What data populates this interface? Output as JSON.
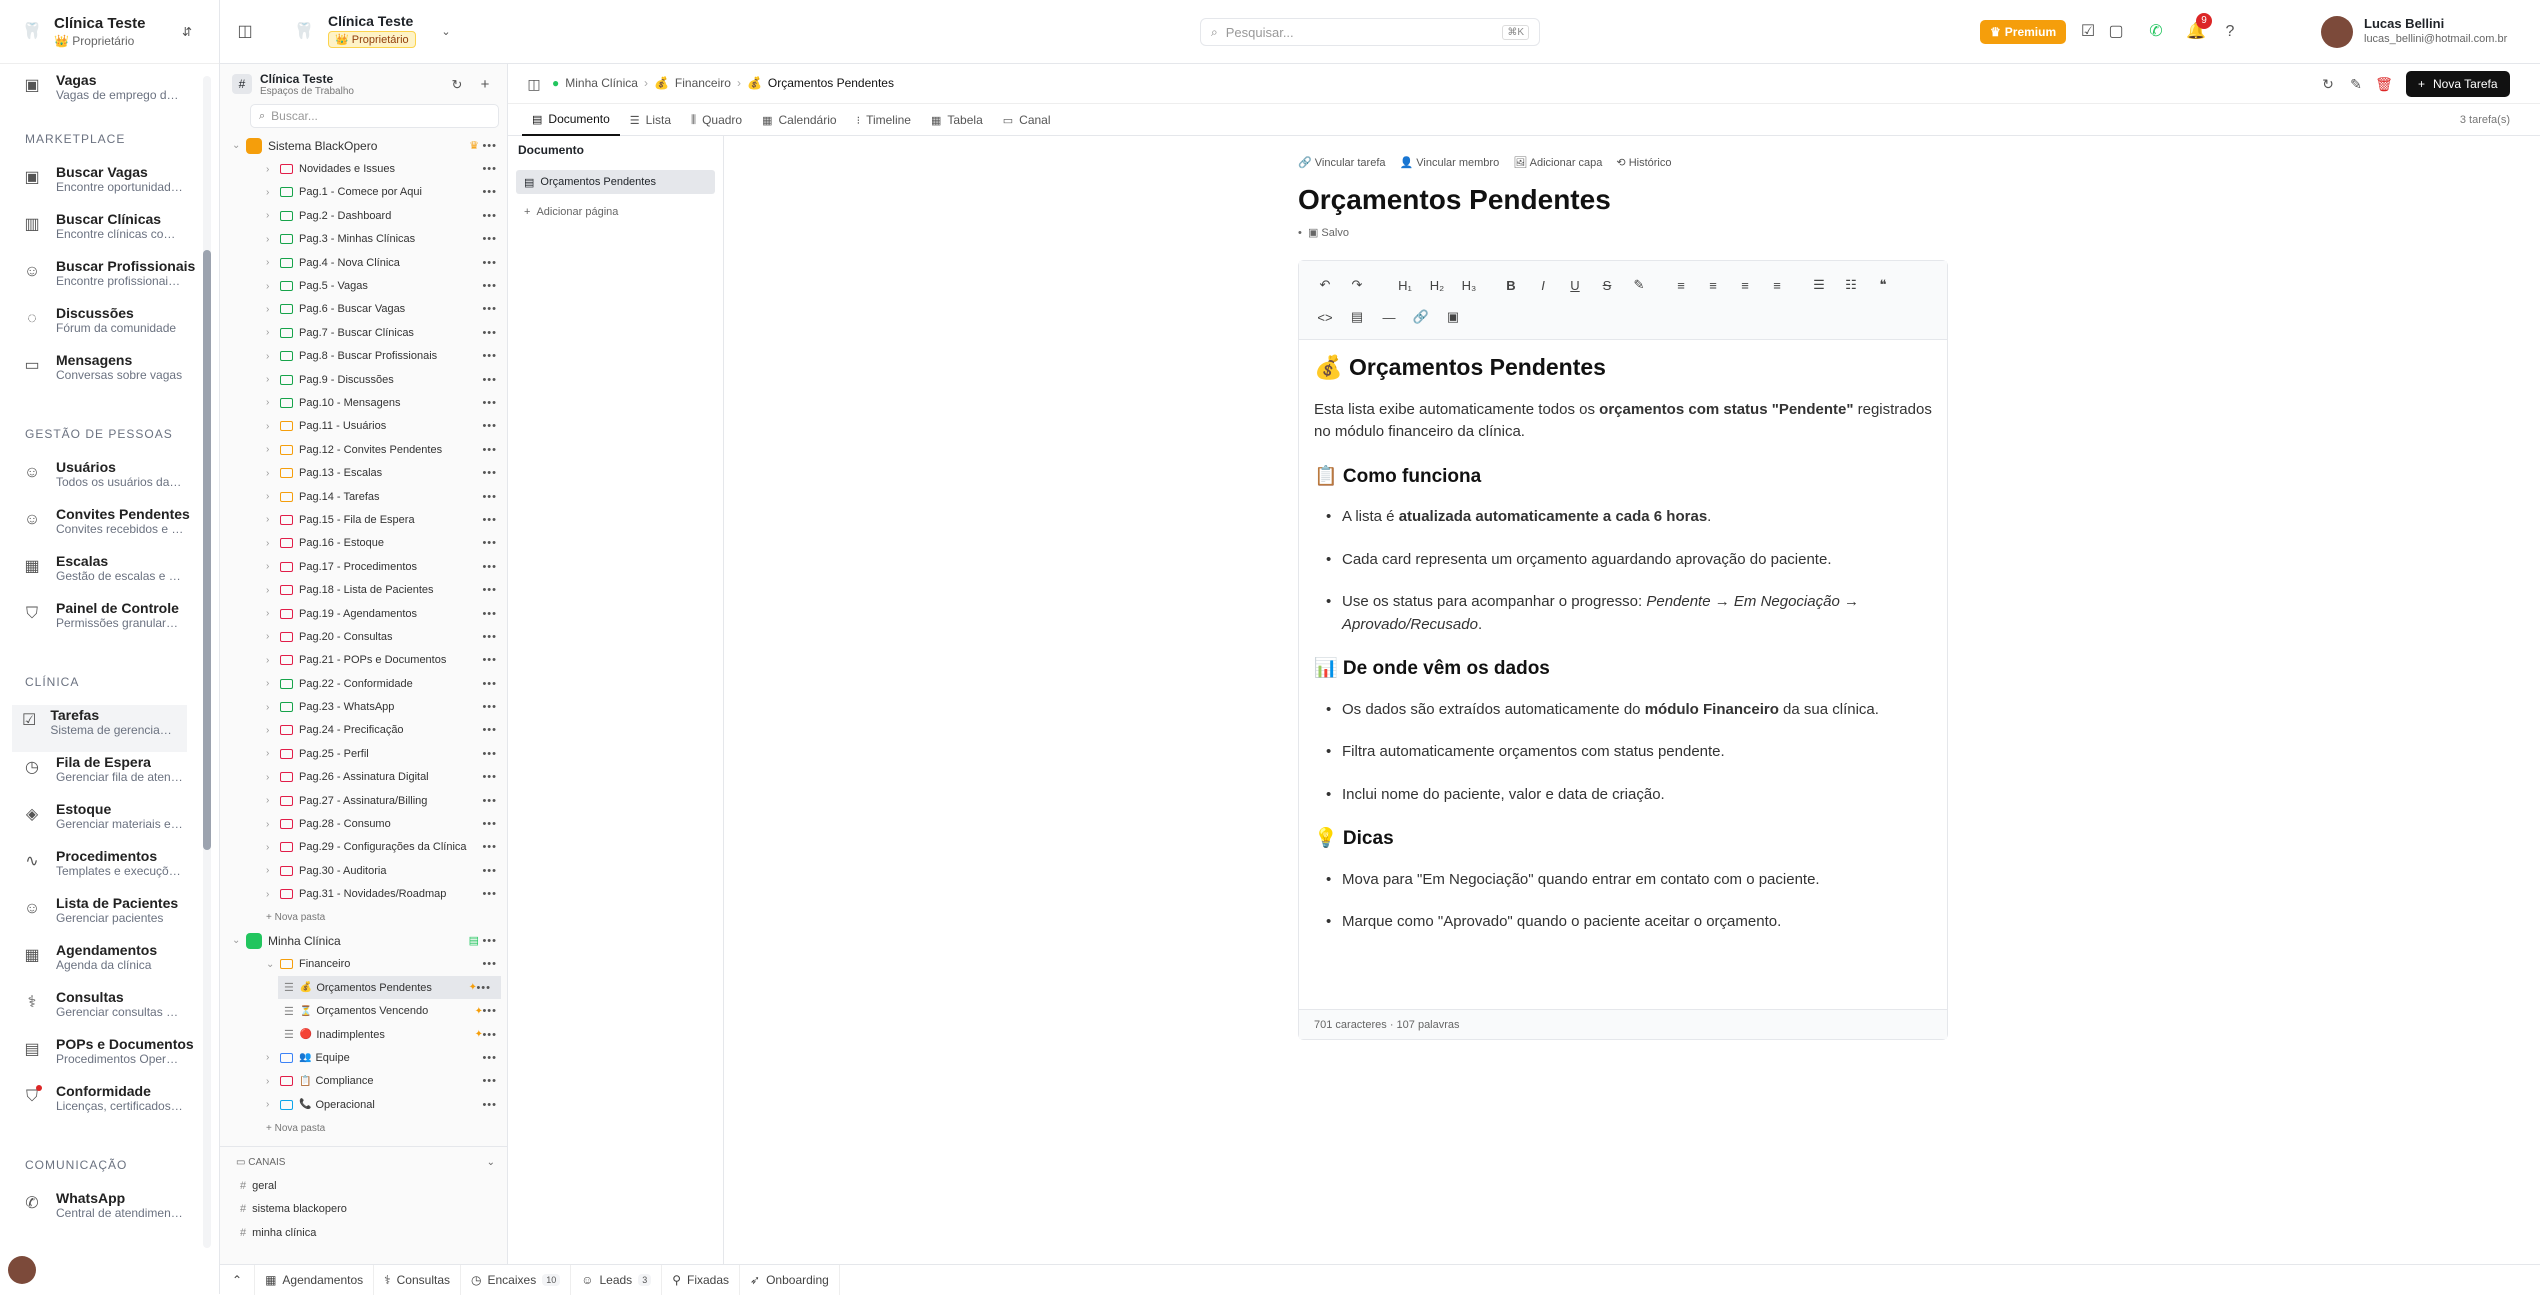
{
  "app": {
    "clinic_name": "Clínica Teste",
    "role": "Proprietário"
  },
  "header": {
    "clinic_name": "Clínica Teste",
    "role": "Proprietário",
    "search_placeholder": "Pesquisar...",
    "search_shortcut": "⌘K",
    "premium_label": "Premium",
    "notif_count": "9",
    "user_name": "Lucas Bellini",
    "user_email": "lucas_bellini@hotmail.com.br"
  },
  "leftnav": {
    "partial_item": {
      "label": "Vagas",
      "desc": "Vagas de emprego da ..."
    },
    "sections": [
      {
        "title": "MARKETPLACE",
        "items": [
          {
            "label": "Buscar Vagas",
            "desc": "Encontre oportunidade...",
            "icon": "briefcase-icon"
          },
          {
            "label": "Buscar Clínicas",
            "desc": "Encontre clínicas com ...",
            "icon": "building-icon"
          },
          {
            "label": "Buscar Profissionais",
            "desc": "Encontre profissionais ...",
            "icon": "users-icon"
          },
          {
            "label": "Discussões",
            "desc": "Fórum da comunidade",
            "icon": "chat-icon"
          },
          {
            "label": "Mensagens",
            "desc": "Conversas sobre vagas",
            "icon": "message-icon"
          }
        ]
      },
      {
        "title": "GESTÃO DE PESSOAS",
        "items": [
          {
            "label": "Usuários",
            "desc": "Todos os usuários da c...",
            "icon": "user-icon"
          },
          {
            "label": "Convites Pendentes",
            "desc": "Convites recebidos e e...",
            "icon": "user-plus-icon"
          },
          {
            "label": "Escalas",
            "desc": "Gestão de escalas e h...",
            "icon": "calendar-icon"
          },
          {
            "label": "Painel de Controle",
            "desc": "Permissões granulares...",
            "icon": "shield-icon"
          }
        ]
      },
      {
        "title": "CLÍNICA",
        "items": [
          {
            "label": "Tarefas",
            "desc": "Sistema de gerenciam...",
            "icon": "checkbox-icon",
            "active": true
          },
          {
            "label": "Fila de Espera",
            "desc": "Gerenciar fila de atend...",
            "icon": "clock-icon"
          },
          {
            "label": "Estoque",
            "desc": "Gerenciar materiais e i...",
            "icon": "package-icon"
          },
          {
            "label": "Procedimentos",
            "desc": "Templates e execuçõe...",
            "icon": "activity-icon"
          },
          {
            "label": "Lista de Pacientes",
            "desc": "Gerenciar pacientes",
            "icon": "users-icon"
          },
          {
            "label": "Agendamentos",
            "desc": "Agenda da clínica",
            "icon": "calendar-icon"
          },
          {
            "label": "Consultas",
            "desc": "Gerenciar consultas m...",
            "icon": "stethoscope-icon"
          },
          {
            "label": "POPs e Documentos",
            "desc": "Procedimentos Operac...",
            "icon": "book-icon"
          },
          {
            "label": "Conformidade",
            "desc": "Licenças, certificados ...",
            "icon": "shield-check-icon"
          }
        ]
      },
      {
        "title": "COMUNICAÇÃO",
        "items": [
          {
            "label": "WhatsApp",
            "desc": "Central de atendiment...",
            "icon": "whatsapp-icon"
          }
        ]
      }
    ]
  },
  "tree": {
    "workspace_title": "Clínica Teste",
    "workspace_sub": "Espaços de Trabalho",
    "search_placeholder": "Buscar...",
    "space1": "Sistema BlackOpero",
    "space1_folders": [
      "Novidades e Issues",
      "Pag.1 - Comece por Aqui",
      "Pag.2 - Dashboard",
      "Pag.3 - Minhas Clínicas",
      "Pag.4 - Nova Clínica",
      "Pag.5 - Vagas",
      "Pag.6 - Buscar Vagas",
      "Pag.7 - Buscar Clínicas",
      "Pag.8 - Buscar Profissionais",
      "Pag.9 - Discussões",
      "Pag.10 - Mensagens",
      "Pag.11 - Usuários",
      "Pag.12 - Convites Pendentes",
      "Pag.13 - Escalas",
      "Pag.14 - Tarefas",
      "Pag.15 - Fila de Espera",
      "Pag.16 - Estoque",
      "Pag.17 - Procedimentos",
      "Pag.18 - Lista de Pacientes",
      "Pag.19 - Agendamentos",
      "Pag.20 - Consultas",
      "Pag.21 - POPs e Documentos",
      "Pag.22 - Conformidade",
      "Pag.23 - WhatsApp",
      "Pag.24 - Precificação",
      "Pag.25 - Perfil",
      "Pag.26 - Assinatura Digital",
      "Pag.27 - Assinatura/Billing",
      "Pag.28 - Consumo",
      "Pag.29 - Configurações da Clínica",
      "Pag.30 - Auditoria",
      "Pag.31 - Novidades/Roadmap"
    ],
    "folder_colors": [
      "#e11d48",
      "#16a34a",
      "#16a34a",
      "#16a34a",
      "#16a34a",
      "#16a34a",
      "#16a34a",
      "#16a34a",
      "#16a34a",
      "#16a34a",
      "#16a34a",
      "#f59e0b",
      "#f59e0b",
      "#f59e0b",
      "#f59e0b",
      "#e11d48",
      "#e11d48",
      "#e11d48",
      "#e11d48",
      "#e11d48",
      "#e11d48",
      "#e11d48",
      "#16a34a",
      "#16a34a",
      "#e11d48",
      "#e11d48",
      "#e11d48",
      "#e11d48",
      "#e11d48",
      "#e11d48",
      "#e11d48",
      "#e11d48"
    ],
    "new_folder": "Nova pasta",
    "space2": "Minha Clínica",
    "financeiro": "Financeiro",
    "lists": [
      {
        "name": "Orçamentos Pendentes",
        "emoji": "💰",
        "active": true
      },
      {
        "name": "Orçamentos Vencendo",
        "emoji": "⏳"
      },
      {
        "name": "Inadimplentes",
        "emoji": "🔴"
      }
    ],
    "other_folders": [
      {
        "name": "Equipe",
        "emoji": "👥"
      },
      {
        "name": "Compliance",
        "emoji": "📋"
      },
      {
        "name": "Operacional",
        "emoji": "📞"
      }
    ],
    "channels_title": "CANAIS",
    "channels": [
      "geral",
      "sistema blackopero",
      "minha clínica"
    ]
  },
  "crumbs": {
    "items": [
      "Minha Clínica",
      "Financeiro",
      "Orçamentos Pendentes"
    ],
    "new_task": "Nova Tarefa"
  },
  "tabs": {
    "items": [
      "Documento",
      "Lista",
      "Quadro",
      "Calendário",
      "Timeline",
      "Tabela",
      "Canal"
    ],
    "count": "3 tarefa(s)"
  },
  "docside": {
    "title": "Documento",
    "page": "Orçamentos Pendentes",
    "add_page": "Adicionar página"
  },
  "doc": {
    "actions": [
      "Vincular tarefa",
      "Vincular membro",
      "Adicionar capa",
      "Histórico"
    ],
    "title": "Orçamentos Pendentes",
    "saved": "Salvo",
    "h2": "💰 Orçamentos Pendentes",
    "intro_a": "Esta lista exibe automaticamente todos os ",
    "intro_b": "orçamentos com status \"Pendente\"",
    "intro_c": " registrados no módulo financeiro da clínica.",
    "s1_title": "📋 Como funciona",
    "s1_li1_a": "A lista é ",
    "s1_li1_b": "atualizada automaticamente a cada 6 horas",
    "s1_li1_c": ".",
    "s1_li2": "Cada card representa um orçamento aguardando aprovação do paciente.",
    "s1_li3_a": "Use os status para acompanhar o progresso: ",
    "s1_li3_b": "Pendente → Em Negociação → Aprovado/Recusado",
    "s1_li3_c": ".",
    "s2_title": "📊 De onde vêm os dados",
    "s2_li1_a": "Os dados são extraídos automaticamente do ",
    "s2_li1_b": "módulo Financeiro",
    "s2_li1_c": " da sua clínica.",
    "s2_li2": "Filtra automaticamente orçamentos com status pendente.",
    "s2_li3": "Inclui nome do paciente, valor e data de criação.",
    "s3_title": "💡 Dicas",
    "s3_li1": "Mova para \"Em Negociação\" quando entrar em contato com o paciente.",
    "s3_li2": "Marque como \"Aprovado\" quando o paciente aceitar o orçamento.",
    "footer": "701 caracteres · 107 palavras"
  },
  "bottombar": [
    {
      "label": "Agendamentos",
      "icon": "calendar-icon"
    },
    {
      "label": "Consultas",
      "icon": "stethoscope-icon"
    },
    {
      "label": "Encaixes",
      "icon": "clock-icon",
      "badge": "10"
    },
    {
      "label": "Leads",
      "icon": "users-icon",
      "badge": "3"
    },
    {
      "label": "Fixadas",
      "icon": "pin-icon"
    },
    {
      "label": "Onboarding",
      "icon": "rocket-icon"
    }
  ],
  "colors": {
    "accent": "#111111",
    "premium": "#f59e0b",
    "notif": "#dc2626",
    "whatsapp": "#22c55e"
  }
}
